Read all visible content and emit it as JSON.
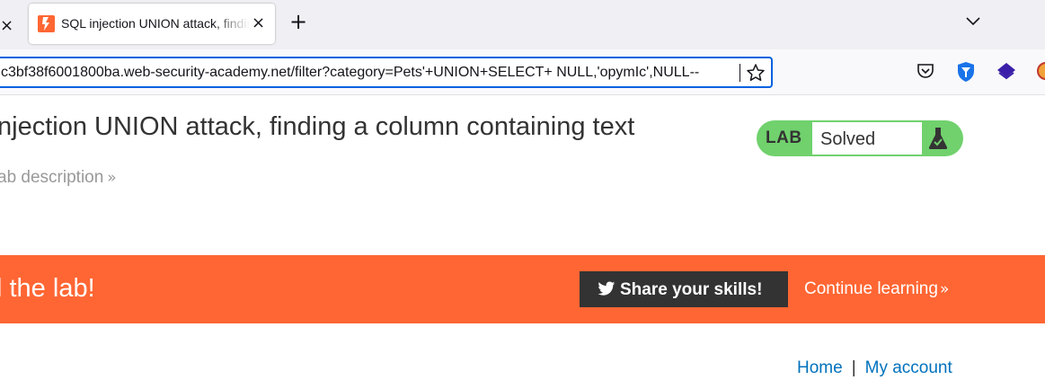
{
  "browser": {
    "prev_tab_close": "×",
    "active_tab": {
      "title": "SQL injection UNION attack, finding a column containing text",
      "close": "×"
    },
    "new_tab": "+",
    "url": "c3bf38f6001800ba.web-security-academy.net/filter?category=Pets'+UNION+SELECT+ NULL,'opymIc',NULL--"
  },
  "page": {
    "title": "njection UNION attack, finding a column containing text",
    "lab_description": "ab description",
    "status": {
      "label": "LAB",
      "value": "Solved"
    },
    "banner": {
      "text": "l the lab!",
      "share_button": "Share your skills!",
      "continue_link": "Continue learning"
    },
    "nav": {
      "home": "Home",
      "separator": "|",
      "account": "My account"
    }
  },
  "colors": {
    "accent_orange": "#ff6633",
    "solved_green": "#70d16d",
    "link_blue": "#0071bc",
    "url_focus_blue": "#0061e0"
  },
  "icons": [
    "portswigger-favicon-icon",
    "chevron-down-icon",
    "bookmark-star-icon",
    "pocket-icon",
    "vpn-shield-icon",
    "extension-stack-icon",
    "extension-partial-icon",
    "flask-icon",
    "twitter-icon"
  ]
}
